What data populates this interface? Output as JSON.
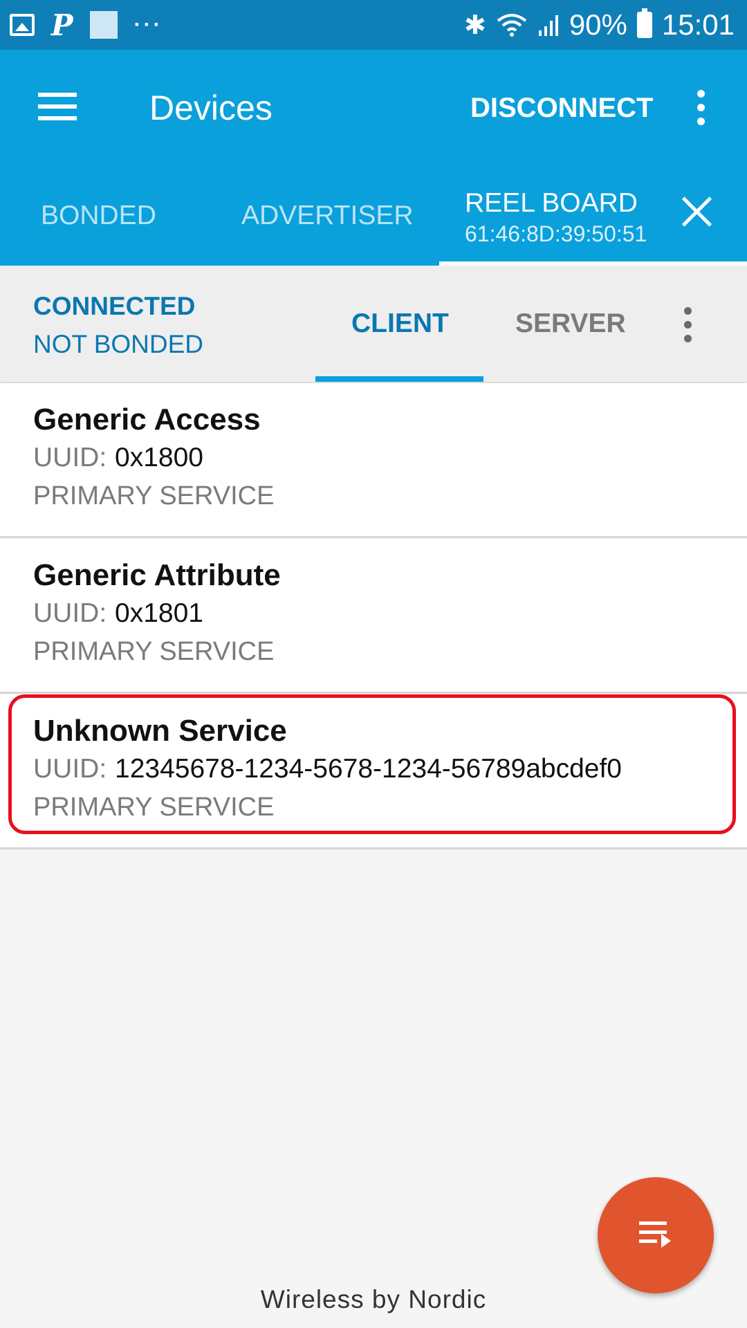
{
  "status_bar": {
    "left_icons": [
      "image-icon",
      "p-icon",
      "square-icon",
      "more-dots-icon"
    ],
    "more_dots": "···",
    "bluetooth": "✱",
    "battery_percent": "90%",
    "time": "15:01"
  },
  "app_bar": {
    "title": "Devices",
    "disconnect_label": "DISCONNECT"
  },
  "tabs": {
    "bonded": "BONDED",
    "advertiser": "ADVERTISER",
    "device_name": "REEL BOARD",
    "device_address": "61:46:8D:39:50:51"
  },
  "device_bar": {
    "connection_state": "CONNECTED",
    "bond_state": "NOT BONDED",
    "client_tab": "CLIENT",
    "server_tab": "SERVER"
  },
  "services": [
    {
      "name": "Generic Access",
      "uuid_label": "UUID:",
      "uuid": "0x1800",
      "type": "PRIMARY SERVICE"
    },
    {
      "name": "Generic Attribute",
      "uuid_label": "UUID:",
      "uuid": "0x1801",
      "type": "PRIMARY SERVICE"
    },
    {
      "name": "Unknown Service",
      "uuid_label": "UUID:",
      "uuid": "12345678-1234-5678-1234-56789abcdef0",
      "type": "PRIMARY SERVICE"
    }
  ],
  "highlight_color": "#e8101e",
  "accent_color": "#0aa0dc",
  "fab_color": "#e0552d",
  "footer": "Wireless by Nordic"
}
